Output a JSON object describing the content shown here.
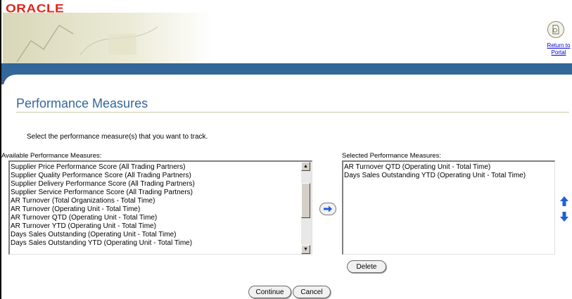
{
  "header": {
    "logo_text": "ORACLE",
    "return_link": "Return to Portal"
  },
  "page": {
    "title": "Performance Measures",
    "instruction": "Select the performance measure(s) that you want to track."
  },
  "available": {
    "label": "Available Performance Measures:",
    "items": [
      "Supplier Price Performance Score (All Trading Partners)",
      "Supplier Quality Performance Score (All Trading Partners)",
      "Supplier Delivery Performance Score (All Trading Partners)",
      "Supplier Service Performance Score (All Trading Partners)",
      "AR Turnover (Total Organizations - Total Time)",
      "AR Turnover (Operating Unit - Total Time)",
      "AR Turnover QTD (Operating Unit - Total Time)",
      "AR Turnover YTD (Operating Unit - Total Time)",
      "Days Sales Outstanding (Operating Unit - Total Time)",
      "Days Sales Outstanding YTD (Operating Unit - Total Time)"
    ]
  },
  "selected": {
    "label": "Selected Performance Measures:",
    "items": [
      "AR Turnover QTD (Operating Unit - Total Time)",
      "Days Sales Outstanding YTD (Operating Unit - Total Time)"
    ]
  },
  "buttons": {
    "delete": "Delete",
    "continue": "Continue",
    "cancel": "Cancel"
  },
  "icons": {
    "move_right": "arrow-right-icon",
    "move_up": "arrow-up-icon",
    "move_down": "arrow-down-icon",
    "portal": "portal-icon"
  },
  "colors": {
    "brand_red": "#e1251b",
    "title_blue": "#336699",
    "band_blue": "#336699",
    "arrow_blue": "#1f5fd6"
  }
}
